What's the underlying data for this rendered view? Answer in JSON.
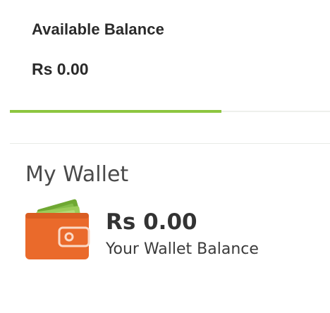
{
  "balance": {
    "title": "Available Balance",
    "amount": "Rs 0.00",
    "progress_fraction": 0.66
  },
  "wallet": {
    "heading": "My Wallet",
    "amount": "Rs 0.00",
    "caption": "Your Wallet Balance",
    "icon": "wallet-icon"
  },
  "colors": {
    "accent_green": "#8dc63f",
    "wallet_orange": "#ea6a2b",
    "cash_green": "#6fa832"
  }
}
